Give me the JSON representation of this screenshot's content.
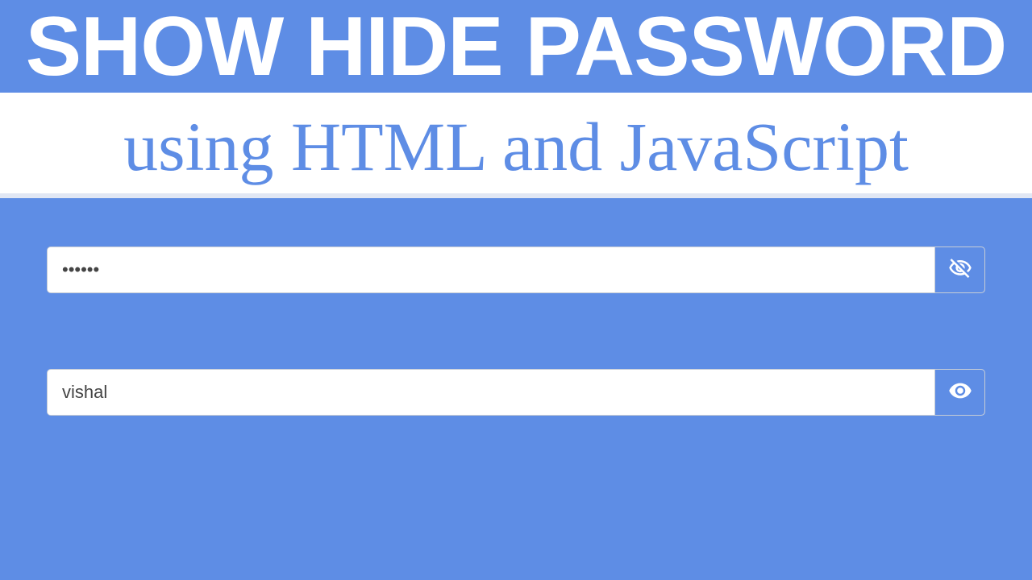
{
  "header": {
    "title": "SHOW HIDE PASSWORD",
    "subtitle": "using HTML and JavaScript"
  },
  "form": {
    "field1": {
      "value": "••••••",
      "type": "password",
      "toggle_icon": "eye-off-icon"
    },
    "field2": {
      "value": "vishal",
      "type": "text",
      "toggle_icon": "eye-icon"
    }
  }
}
